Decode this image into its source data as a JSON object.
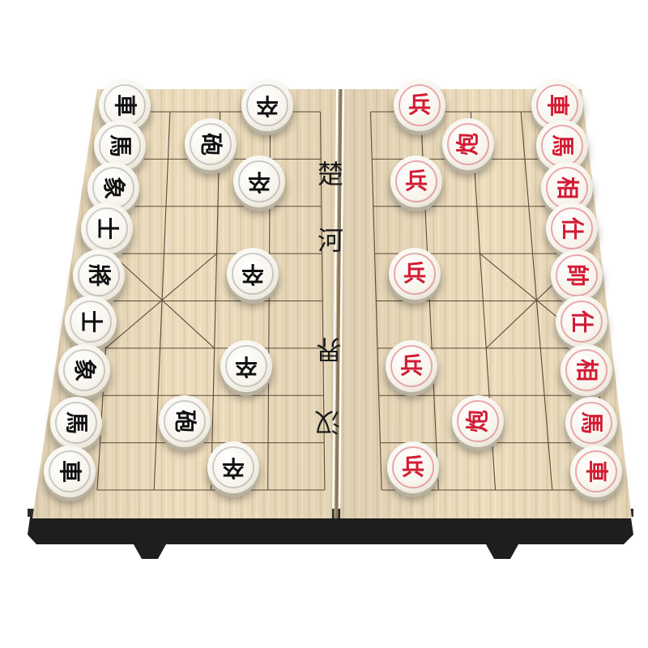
{
  "river": [
    {
      "text": "楚"
    },
    {
      "text": "河"
    },
    {
      "text": "界"
    },
    {
      "text": "汉"
    }
  ],
  "pieces": {
    "black": [
      {
        "text": "車",
        "name": "black-chariot-top"
      },
      {
        "text": "馬",
        "name": "black-horse-top"
      },
      {
        "text": "象",
        "name": "black-elephant-top"
      },
      {
        "text": "士",
        "name": "black-advisor-top"
      },
      {
        "text": "將",
        "name": "black-general"
      },
      {
        "text": "士",
        "name": "black-advisor-bottom"
      },
      {
        "text": "象",
        "name": "black-elephant-bottom"
      },
      {
        "text": "馬",
        "name": "black-horse-bottom"
      },
      {
        "text": "車",
        "name": "black-chariot-bottom"
      },
      {
        "text": "砲",
        "name": "black-cannon-top"
      },
      {
        "text": "砲",
        "name": "black-cannon-bottom"
      },
      {
        "text": "卒",
        "name": "black-soldier-1"
      },
      {
        "text": "卒",
        "name": "black-soldier-2"
      },
      {
        "text": "卒",
        "name": "black-soldier-3"
      },
      {
        "text": "卒",
        "name": "black-soldier-4"
      },
      {
        "text": "卒",
        "name": "black-soldier-5"
      }
    ],
    "red": [
      {
        "text": "車",
        "name": "red-chariot-top"
      },
      {
        "text": "馬",
        "name": "red-horse-top"
      },
      {
        "text": "相",
        "name": "red-minister-top"
      },
      {
        "text": "仕",
        "name": "red-advisor-top"
      },
      {
        "text": "帥",
        "name": "red-marshal"
      },
      {
        "text": "仕",
        "name": "red-advisor-bottom"
      },
      {
        "text": "相",
        "name": "red-minister-bottom"
      },
      {
        "text": "馬",
        "name": "red-horse-bottom"
      },
      {
        "text": "車",
        "name": "red-chariot-bottom"
      },
      {
        "text": "炮",
        "name": "red-cannon-top"
      },
      {
        "text": "炮",
        "name": "red-cannon-bottom"
      },
      {
        "text": "兵",
        "name": "red-soldier-1"
      },
      {
        "text": "兵",
        "name": "red-soldier-2"
      },
      {
        "text": "兵",
        "name": "red-soldier-3"
      },
      {
        "text": "兵",
        "name": "red-soldier-4"
      },
      {
        "text": "兵",
        "name": "red-soldier-5"
      }
    ]
  },
  "colors": {
    "wood": "#ecdcbd",
    "grid": "#5a4a38",
    "black_text": "#111111",
    "red_text": "#d21c33",
    "base": "#1e1e1e"
  }
}
